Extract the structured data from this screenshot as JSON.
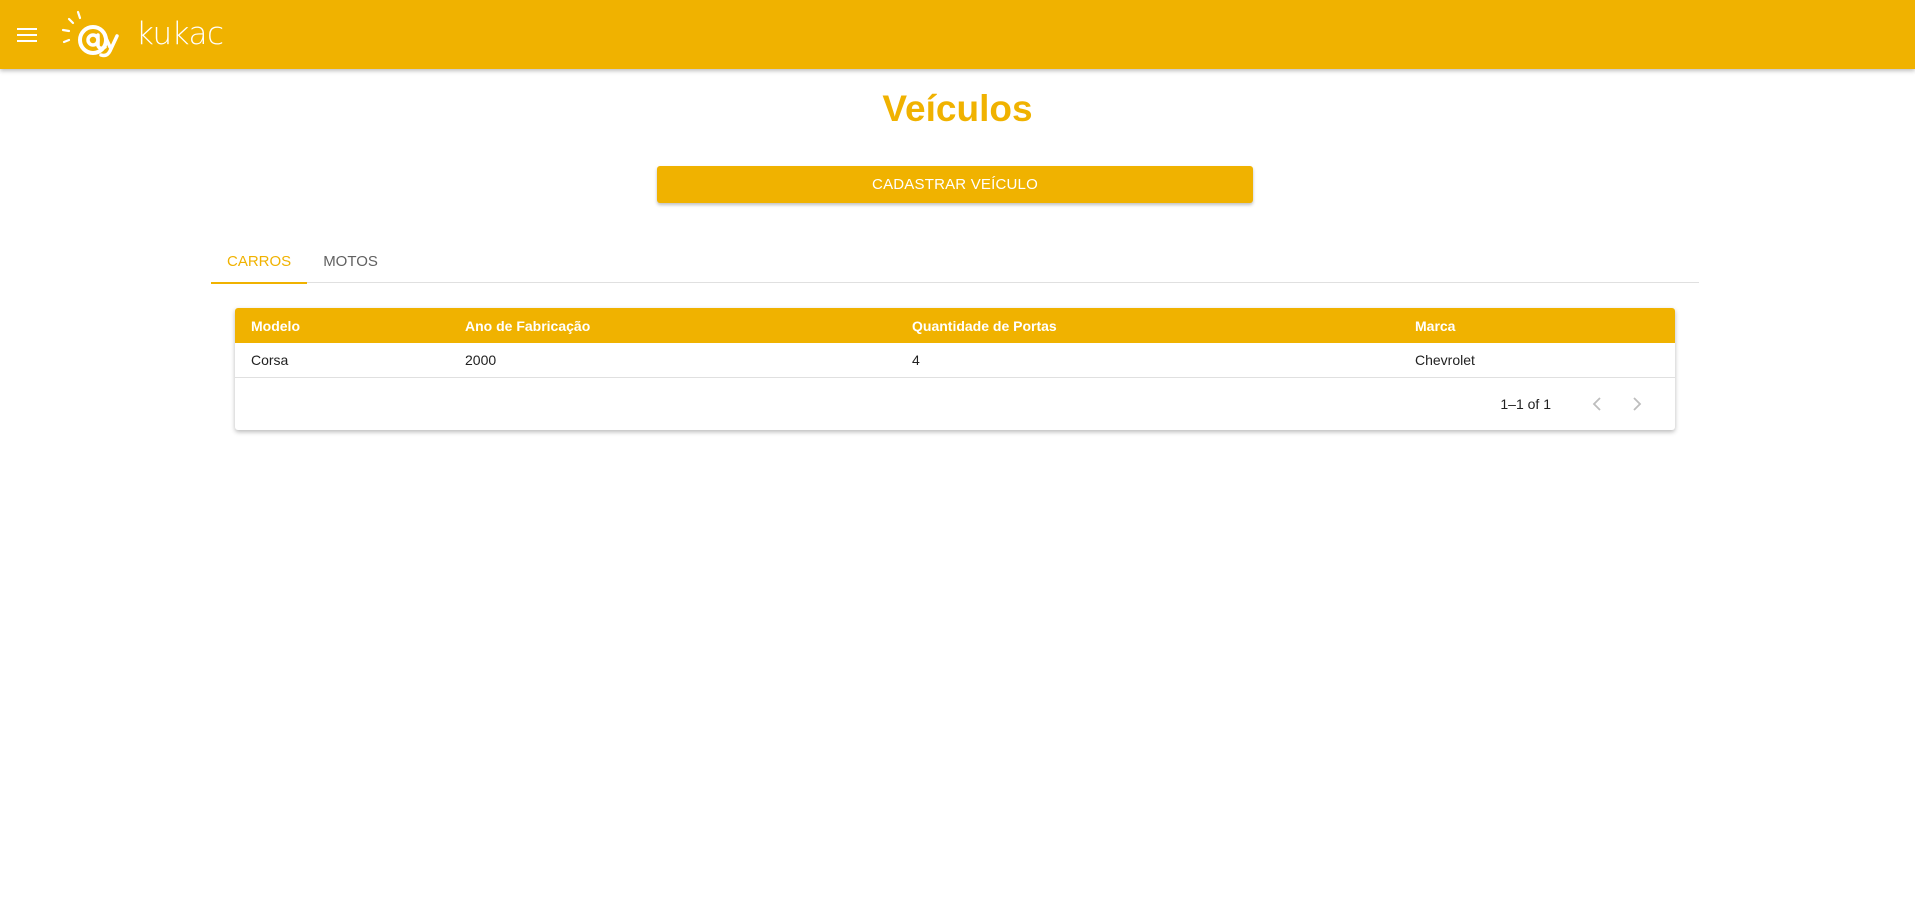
{
  "header": {
    "logo_text": "kukac",
    "menu_icon": "menu-icon",
    "bar_color": "#f0b200"
  },
  "main": {
    "title": "Veículos",
    "register_button": "CADASTRAR VEÍCULO",
    "tabs": [
      {
        "label": "CARROS",
        "active": true
      },
      {
        "label": "MOTOS",
        "active": false
      }
    ]
  },
  "table": {
    "columns": [
      "Modelo",
      "Ano de Fabricação",
      "Quantidade de Portas",
      "Marca"
    ],
    "rows": [
      [
        "Corsa",
        "2000",
        "4",
        "Chevrolet"
      ]
    ],
    "pagination": {
      "range": "1–1 of 1",
      "prev_icon": "chevron-left-icon",
      "next_icon": "chevron-right-icon"
    }
  },
  "colors": {
    "accent": "#f0b200",
    "header_text": "#ffffff"
  }
}
